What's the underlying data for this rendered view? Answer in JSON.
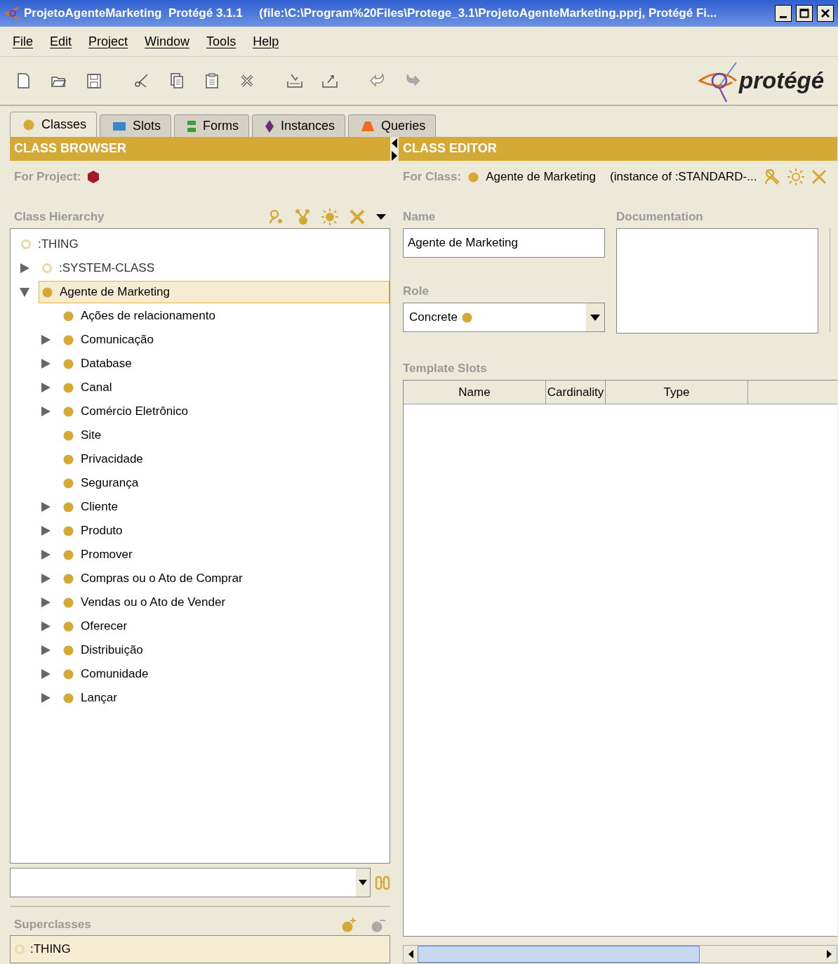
{
  "window": {
    "title": "ProjetoAgenteMarketing  Protégé 3.1.1     (file:\\C:\\Program%20Files\\Protege_3.1\\ProjetoAgenteMarketing.pprj, Protégé Fi..."
  },
  "menu": [
    "File",
    "Edit",
    "Project",
    "Window",
    "Tools",
    "Help"
  ],
  "toolbar": [
    {
      "kind": "new"
    },
    {
      "kind": "open"
    },
    {
      "kind": "save"
    },
    {
      "kind": "cut"
    },
    {
      "kind": "copy"
    },
    {
      "kind": "paste"
    },
    {
      "kind": "delete"
    },
    {
      "kind": "import"
    },
    {
      "kind": "export"
    },
    {
      "kind": "undo"
    },
    {
      "kind": "redo"
    }
  ],
  "logo": "protégé",
  "tabs": [
    {
      "label": "Classes",
      "kind": "class",
      "selected": true
    },
    {
      "label": "Slots",
      "kind": "slot",
      "selected": false
    },
    {
      "label": "Forms",
      "kind": "form",
      "selected": false
    },
    {
      "label": "Instances",
      "kind": "instance",
      "selected": false
    },
    {
      "label": "Queries",
      "kind": "query",
      "selected": false
    }
  ],
  "class_browser": {
    "title": "CLASS BROWSER",
    "for_project_label": "For Project:",
    "hierarchy_label": "Class Hierarchy",
    "tree": [
      {
        "label": ":THING",
        "kind": "system",
        "selected": false,
        "children": [
          {
            "label": ":SYSTEM-CLASS",
            "kind": "system",
            "expanded": false,
            "selected": false
          },
          {
            "label": "Agente de Marketing",
            "kind": "class",
            "expanded": true,
            "selected": true,
            "children": [
              {
                "label": "Ações de relacionamento",
                "kind": "class",
                "selected": false
              },
              {
                "label": "Comunicação",
                "kind": "class",
                "expanded": false,
                "selected": false
              },
              {
                "label": "Database",
                "kind": "class",
                "expanded": false,
                "selected": false
              },
              {
                "label": "Canal",
                "kind": "class",
                "expanded": false,
                "selected": false
              },
              {
                "label": "Comércio Eletrônico",
                "kind": "class",
                "expanded": false,
                "selected": false
              },
              {
                "label": "Site",
                "kind": "class",
                "selected": false
              },
              {
                "label": "Privacidade",
                "kind": "class",
                "selected": false
              },
              {
                "label": "Segurança",
                "kind": "class",
                "selected": false
              },
              {
                "label": "Cliente",
                "kind": "class",
                "expanded": false,
                "selected": false
              },
              {
                "label": "Produto",
                "kind": "class",
                "expanded": false,
                "selected": false
              },
              {
                "label": "Promover",
                "kind": "class",
                "expanded": false,
                "selected": false
              },
              {
                "label": "Compras ou o Ato de Comprar",
                "kind": "class",
                "expanded": false,
                "selected": false
              },
              {
                "label": "Vendas ou o Ato de Vender",
                "kind": "class",
                "expanded": false,
                "selected": false
              },
              {
                "label": "Oferecer",
                "kind": "class",
                "expanded": false,
                "selected": false
              },
              {
                "label": "Distribuição",
                "kind": "class",
                "expanded": false,
                "selected": false
              },
              {
                "label": "Comunidade",
                "kind": "class",
                "expanded": false,
                "selected": false
              },
              {
                "label": "Lançar",
                "kind": "class",
                "expanded": false,
                "selected": false
              }
            ]
          }
        ]
      }
    ],
    "superclasses_label": "Superclasses",
    "superclasses": [
      {
        "label": ":THING",
        "kind": "system"
      }
    ]
  },
  "class_editor": {
    "title": "CLASS EDITOR",
    "for_class_label": "For Class:",
    "class_name": "Agente de Marketing",
    "instance_of": "(instance of :STANDARD-...",
    "name_label": "Name",
    "name_value": "Agente de Marketing",
    "documentation_label": "Documentation",
    "role_label": "Role",
    "role_value": "Concrete",
    "template_slots_label": "Template Slots",
    "columns": [
      "Name",
      "Cardinality",
      "Type"
    ]
  }
}
